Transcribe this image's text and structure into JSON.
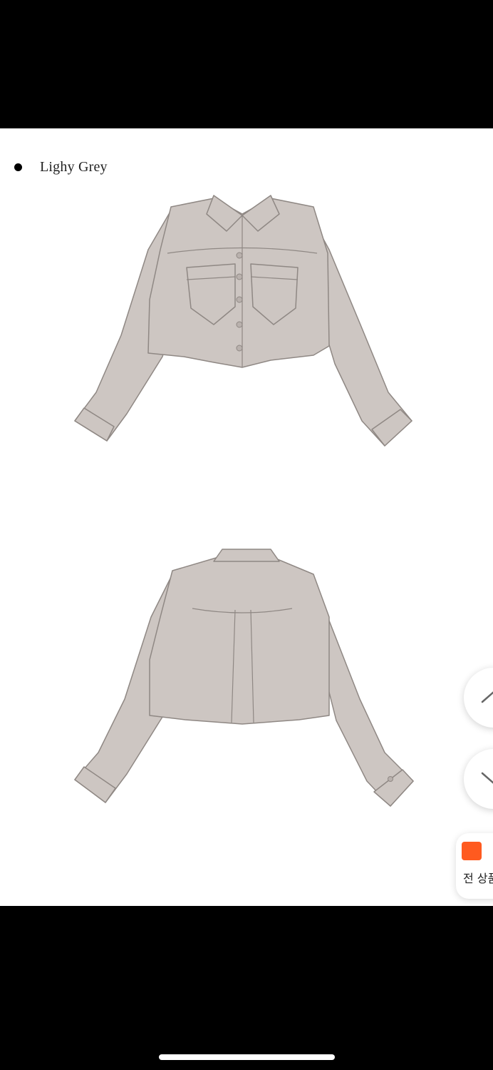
{
  "product": {
    "color_bullet_label": "Lighy Grey"
  },
  "images": [
    {
      "view": "front",
      "description_icon": "cropped-shirt-front"
    },
    {
      "view": "back",
      "description_icon": "cropped-shirt-back"
    }
  ],
  "floating_controls": {
    "scroll_up_icon": "chevron-up-icon",
    "scroll_down_icon": "chevron-down-icon",
    "fab_label": "전 상품"
  },
  "colors": {
    "shirt_fill": "#cdc6c2",
    "shirt_stroke": "#8f8884",
    "accent": "#ff5a1f"
  }
}
